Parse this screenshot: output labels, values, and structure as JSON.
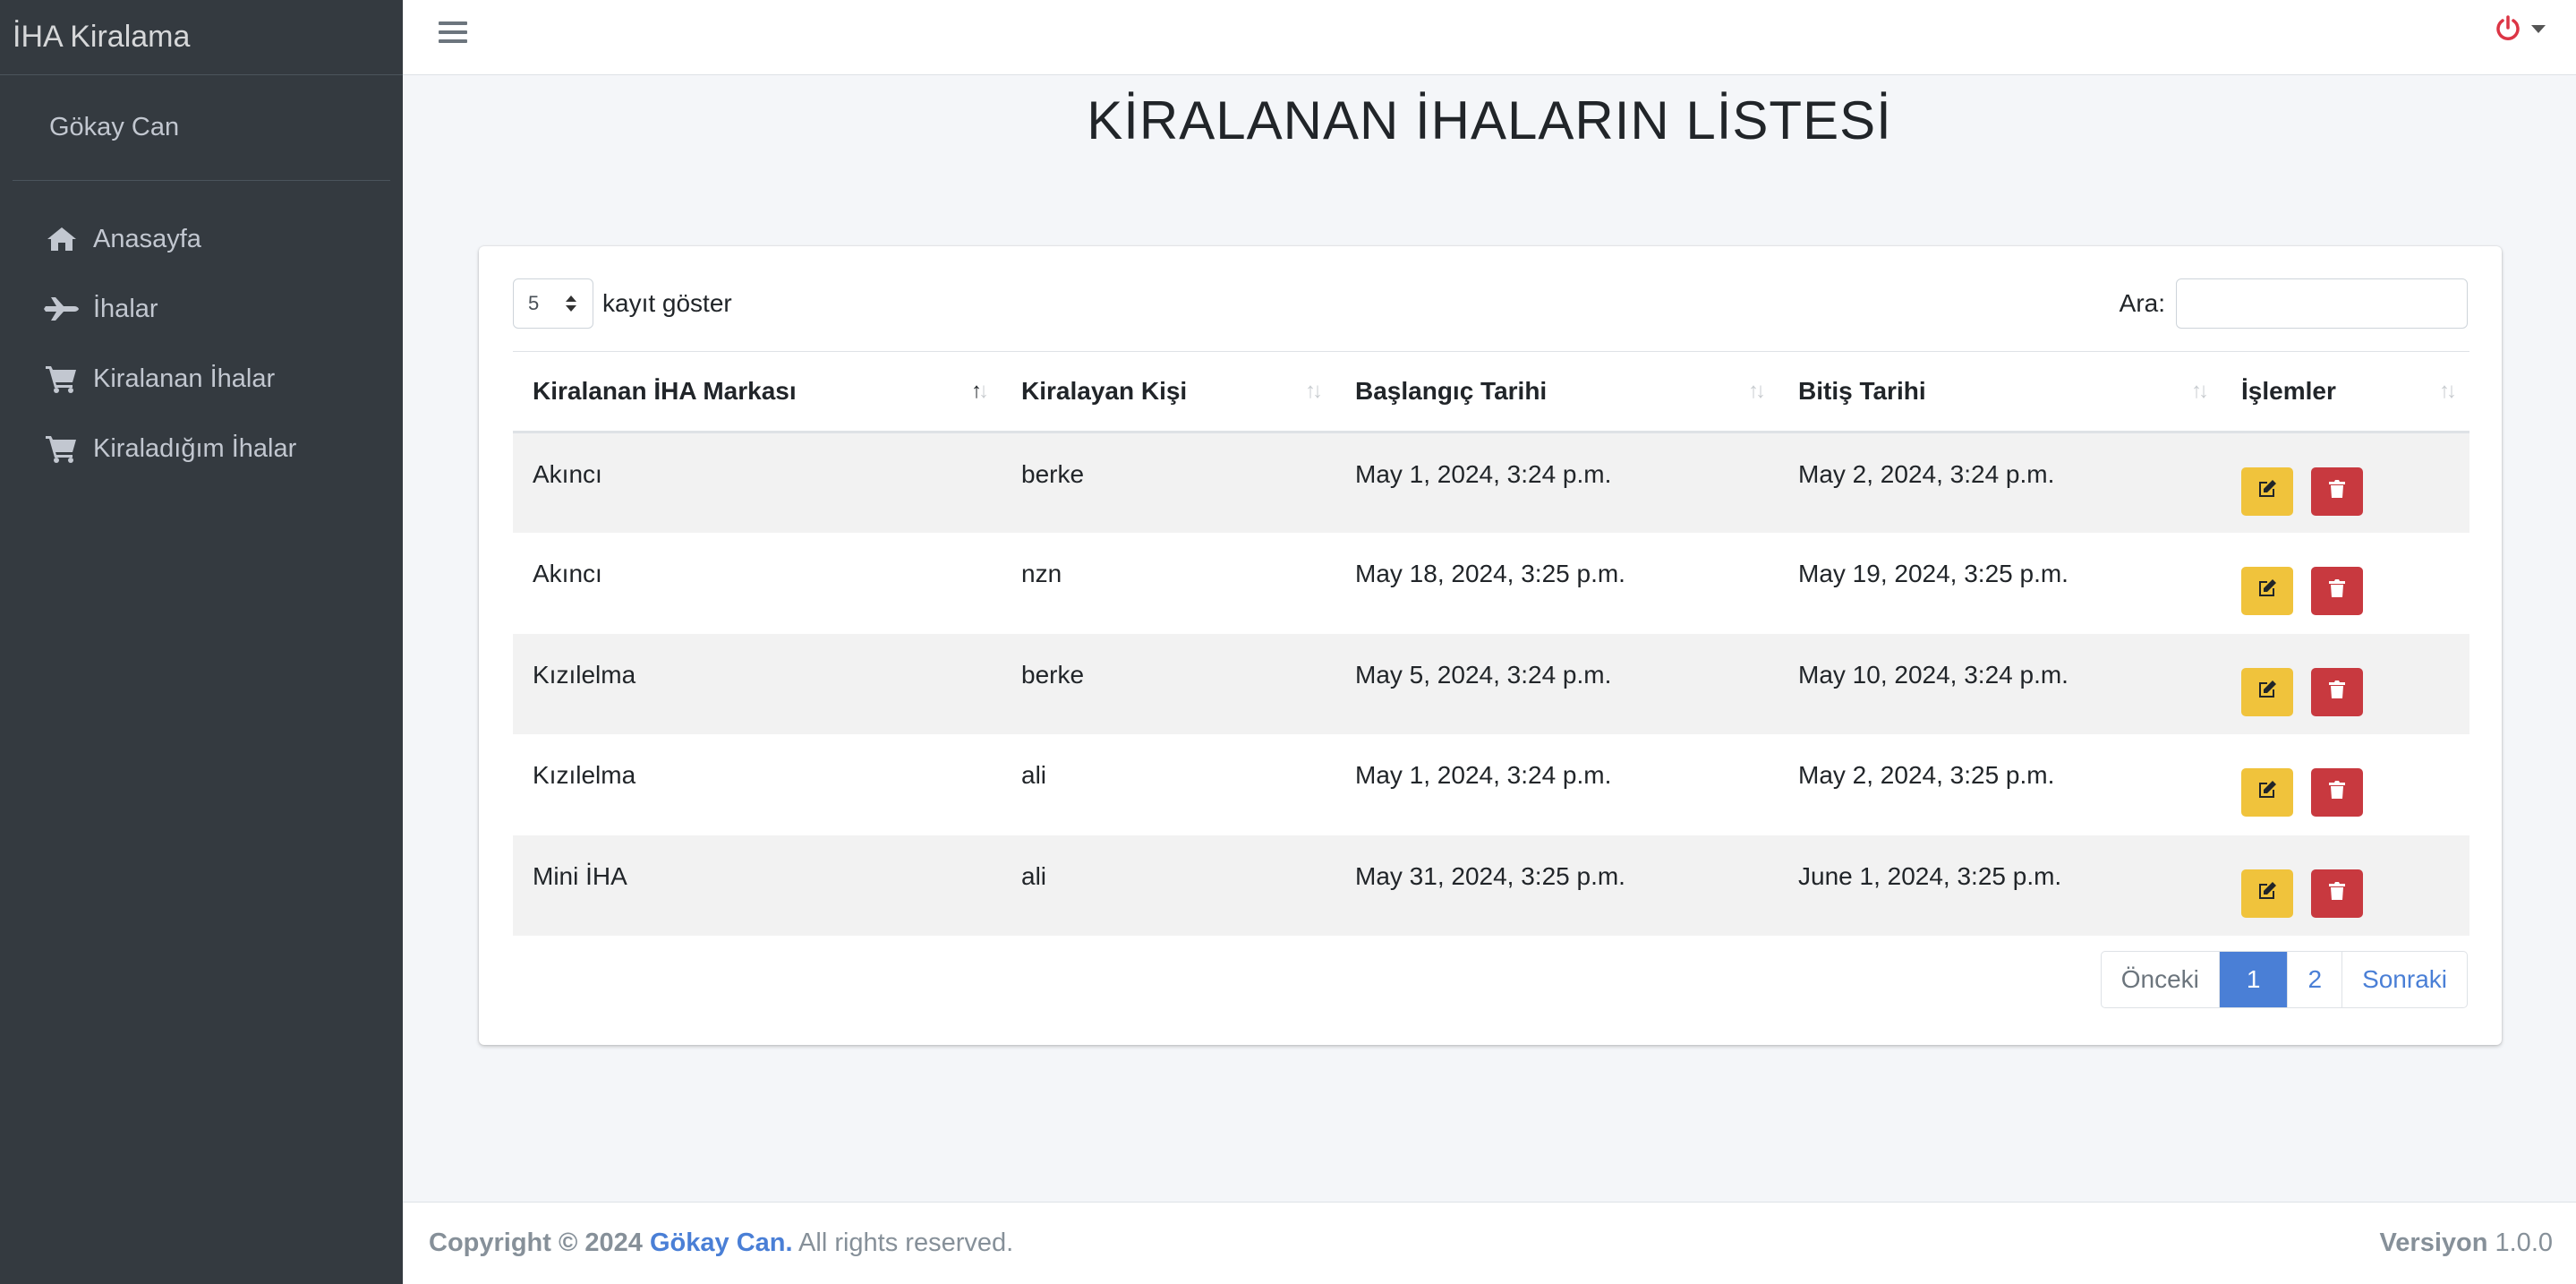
{
  "sidebar": {
    "brand": "İHA Kiralama",
    "user": "Gökay Can",
    "items": [
      {
        "label": "Anasayfa",
        "icon": "home-icon"
      },
      {
        "label": "İhalar",
        "icon": "plane-icon"
      },
      {
        "label": "Kiralanan İhalar",
        "icon": "cart-icon"
      },
      {
        "label": "Kiraladığım İhalar",
        "icon": "cart-icon"
      }
    ]
  },
  "topbar": {
    "menu_icon": "hamburger-icon",
    "power_icon": "power-icon",
    "power_color": "#dc3545"
  },
  "page": {
    "title": "KİRALANAN İHALARIN LİSTESİ"
  },
  "table_controls": {
    "length_value": "5",
    "length_label": "kayıt göster",
    "search_label": "Ara:",
    "search_value": ""
  },
  "table": {
    "headers": [
      "Kiralanan İHA Markası",
      "Kiralayan Kişi",
      "Başlangıç Tarihi",
      "Bitiş Tarihi",
      "İşlemler"
    ],
    "rows": [
      [
        "Akıncı",
        "berke",
        "May 1, 2024, 3:24 p.m.",
        "May 2, 2024, 3:24 p.m."
      ],
      [
        "Akıncı",
        "nzn",
        "May 18, 2024, 3:25 p.m.",
        "May 19, 2024, 3:25 p.m."
      ],
      [
        "Kızılelma",
        "berke",
        "May 5, 2024, 3:24 p.m.",
        "May 10, 2024, 3:24 p.m."
      ],
      [
        "Kızılelma",
        "ali",
        "May 1, 2024, 3:24 p.m.",
        "May 2, 2024, 3:25 p.m."
      ],
      [
        "Mini İHA",
        "ali",
        "May 31, 2024, 3:25 p.m.",
        "June 1, 2024, 3:25 p.m."
      ]
    ],
    "edit_icon": "edit-icon",
    "delete_icon": "trash-icon",
    "edit_color": "#f0c33c",
    "delete_color": "#c8393f"
  },
  "pagination": {
    "prev": "Önceki",
    "pages": [
      "1",
      "2"
    ],
    "active": "1",
    "next": "Sonraki"
  },
  "footer": {
    "copyright": "Copyright © 2024",
    "author": "Gökay Can.",
    "rights": "All rights reserved.",
    "version_label": "Versiyon",
    "version": "1.0.0"
  }
}
